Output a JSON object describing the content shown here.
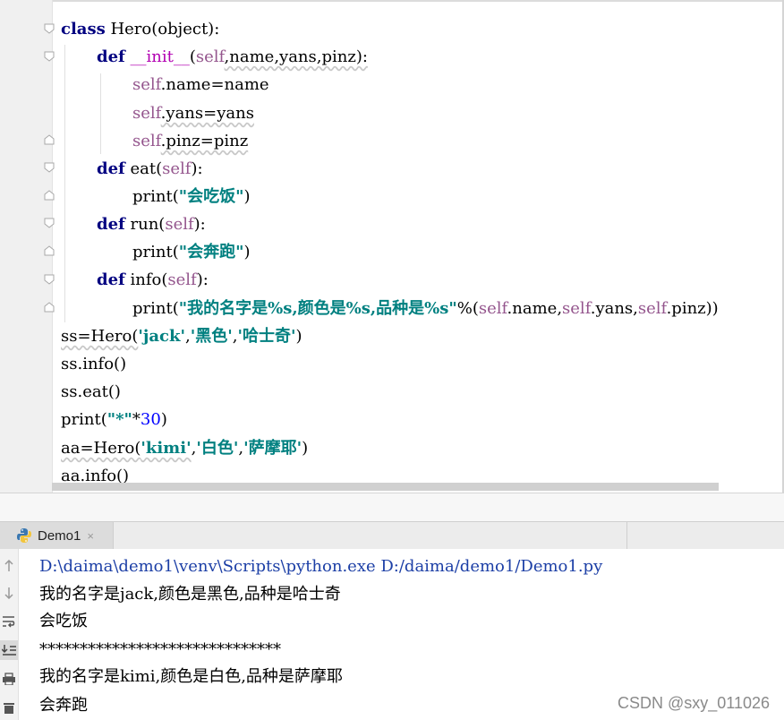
{
  "editor": {
    "code_lines": [
      [
        "class",
        " Hero(object):"
      ],
      [
        "def",
        " __init__",
        "(",
        "self",
        ",name,yans,pinz):"
      ],
      [
        "self",
        ".name=name"
      ],
      [
        "self",
        ".yans=yans"
      ],
      [
        "self",
        ".pinz=pinz"
      ],
      [
        "def",
        " eat(",
        "self",
        "):"
      ],
      [
        "print(",
        "\"会吃饭\"",
        ")"
      ],
      [
        "def",
        " run(",
        "self",
        "):"
      ],
      [
        "print(",
        "\"会奔跑\"",
        ")"
      ],
      [
        "def",
        " info(",
        "self",
        "):"
      ],
      [
        "print(",
        "\"我的名字是%s,颜色是%s,品种是%s\"",
        "%(",
        "self",
        ".name,",
        "self",
        ".yans,",
        "self",
        ".pinz))"
      ],
      [
        "ss=Hero(",
        "'jack'",
        ",",
        "'黑色'",
        ",",
        "'哈士奇'",
        ")"
      ],
      [
        "ss.info()"
      ],
      [
        "ss.eat()"
      ],
      [
        "print(",
        "\"*\"",
        "*",
        "30",
        ")"
      ],
      [
        "aa=Hero(",
        "'kimi'",
        ",",
        "'白色'",
        ",",
        "'萨摩耶'",
        ")"
      ],
      [
        "aa.info()"
      ]
    ]
  },
  "run_panel": {
    "tab_label": "Demo1",
    "tab_close": "×",
    "output": [
      "D:\\daima\\demo1\\venv\\Scripts\\python.exe D:/daima/demo1/Demo1.py",
      "我的名字是jack,颜色是黑色,品种是哈士奇",
      "会吃饭",
      "******************************",
      "我的名字是kimi,颜色是白色,品种是萨摩耶",
      "会奔跑"
    ]
  },
  "watermark": "CSDN @sxy_011026",
  "colors": {
    "keyword": "#000080",
    "self": "#94558d",
    "string": "#008080",
    "number": "#0000ff",
    "dunder": "#b200b2",
    "command": "#1c3fa6"
  },
  "icons": {
    "tab_icon": "python-icon",
    "toolbar": [
      "arrow-up-icon",
      "arrow-down-icon",
      "soft-wrap-icon",
      "scroll-to-end-icon",
      "print-icon",
      "trash-icon"
    ]
  }
}
